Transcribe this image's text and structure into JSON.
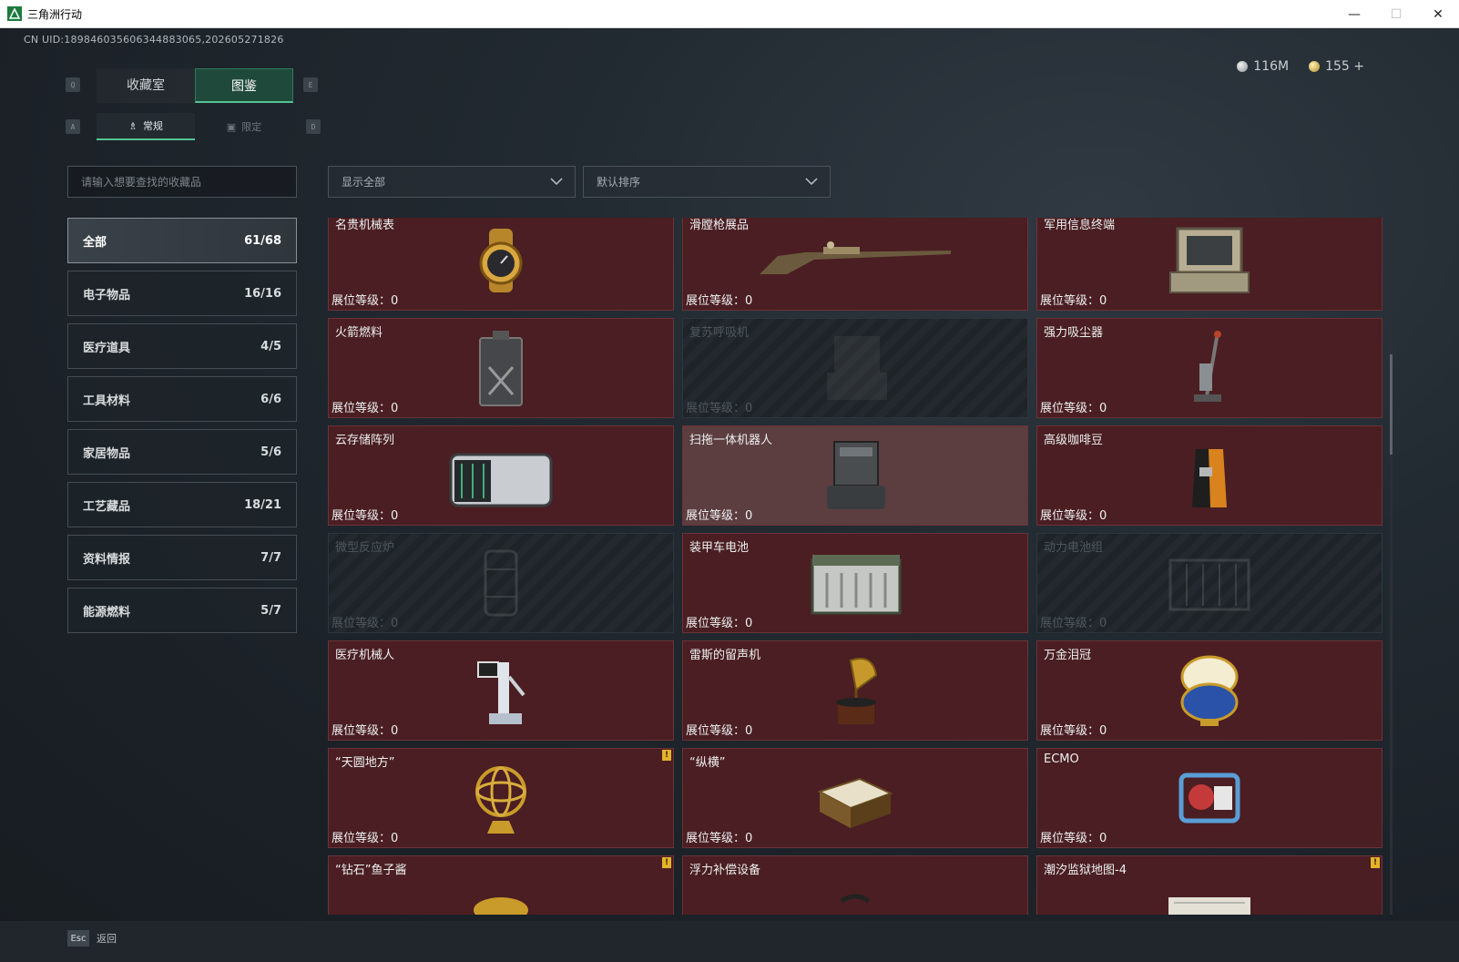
{
  "window": {
    "title": "三角洲行动",
    "minimize": "—",
    "maximize": "☐",
    "close": "✕"
  },
  "header": {
    "uid": "CN UID:1898460356063448830​65,202605271826",
    "silver": "116M",
    "gold": "155 +"
  },
  "keys": {
    "q": "Q",
    "e": "E",
    "a": "A",
    "d": "D"
  },
  "tabs": [
    {
      "label": "收藏室"
    },
    {
      "label": "图鉴"
    }
  ],
  "subtabs": [
    {
      "label": "常规",
      "icon": "♗"
    },
    {
      "label": "限定",
      "icon": "▣"
    }
  ],
  "search": {
    "placeholder": "请输入想要查找的收藏品"
  },
  "filters": {
    "show": "显示全部",
    "sort": "默认排序"
  },
  "categories": [
    {
      "label": "全部",
      "count": "61/68"
    },
    {
      "label": "电子物品",
      "count": "16/16"
    },
    {
      "label": "医疗道具",
      "count": "4/5"
    },
    {
      "label": "工具材料",
      "count": "6/6"
    },
    {
      "label": "家居物品",
      "count": "5/6"
    },
    {
      "label": "工艺藏品",
      "count": "18/21"
    },
    {
      "label": "资料情报",
      "count": "7/7"
    },
    {
      "label": "能源燃料",
      "count": "5/7"
    }
  ],
  "level_label": "展位等级：",
  "cards": [
    {
      "name": "名贵机械表",
      "level": "0",
      "icon": "watch-icon"
    },
    {
      "name": "滑膛枪展品",
      "level": "0",
      "icon": "musket-icon"
    },
    {
      "name": "军用信息终端",
      "level": "0",
      "icon": "terminal-icon"
    },
    {
      "name": "火箭燃料",
      "level": "0",
      "icon": "fuel-can-icon"
    },
    {
      "name": "复苏呼吸机",
      "level": "0",
      "icon": "ventilator-icon"
    },
    {
      "name": "强力吸尘器",
      "level": "0",
      "icon": "vacuum-icon"
    },
    {
      "name": "云存储阵列",
      "level": "0",
      "icon": "storage-array-icon"
    },
    {
      "name": "扫拖一体机器人",
      "level": "0",
      "icon": "mop-robot-icon"
    },
    {
      "name": "高级咖啡豆",
      "level": "0",
      "icon": "coffee-bag-icon"
    },
    {
      "name": "微型反应炉",
      "level": "0",
      "icon": "reactor-icon"
    },
    {
      "name": "装甲车电池",
      "level": "0",
      "icon": "battery-icon"
    },
    {
      "name": "动力电池组",
      "level": "0",
      "icon": "battery-pack-icon"
    },
    {
      "name": "医疗机械人",
      "level": "0",
      "icon": "medical-robot-icon"
    },
    {
      "name": "雷斯的留声机",
      "level": "0",
      "icon": "gramophone-icon"
    },
    {
      "name": "万金泪冠",
      "level": "0",
      "icon": "jewel-egg-icon"
    },
    {
      "name": "“天圆地方”",
      "level": "0",
      "icon": "armillary-icon"
    },
    {
      "name": "“纵横”",
      "level": "0",
      "icon": "chess-box-icon"
    },
    {
      "name": "ECMO",
      "level": "0",
      "icon": "ecmo-icon"
    },
    {
      "name": "“钻石”鱼子酱",
      "level": "",
      "icon": "caviar-icon"
    },
    {
      "name": "浮力补偿设备",
      "level": "",
      "icon": "bcd-icon"
    },
    {
      "name": "潮汐监狱地图-4",
      "level": "",
      "icon": "map-icon"
    }
  ],
  "footer": {
    "esc_key": "Esc",
    "back": "返回"
  }
}
